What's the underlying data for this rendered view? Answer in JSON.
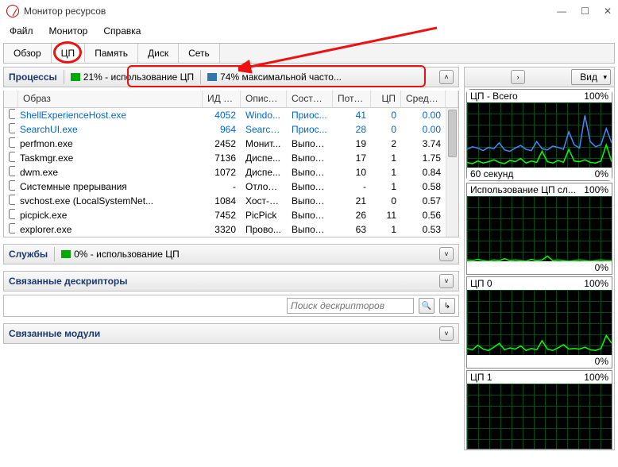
{
  "window": {
    "title": "Монитор ресурсов"
  },
  "winbuttons": {
    "min": "—",
    "max": "☐",
    "close": "✕"
  },
  "menu": {
    "file": "Файл",
    "monitor": "Монитор",
    "help": "Справка"
  },
  "tabs": {
    "overview": "Обзор",
    "cpu": "ЦП",
    "memory": "Память",
    "disk": "Диск",
    "network": "Сеть"
  },
  "processes": {
    "title": "Процессы",
    "chip_cpu": "21% - использование ЦП",
    "chip_freq": "74% максимальной часто...",
    "columns": {
      "image": "Образ",
      "pid": "ИД п...",
      "desc": "Описа...",
      "status": "Состоя...",
      "threads": "Потоки",
      "cpu": "ЦП",
      "avg": "Средн..."
    },
    "rows": [
      {
        "image": "ShellExperienceHost.exe",
        "pid": "4052",
        "desc": "Windo...",
        "status": "Приос...",
        "threads": "41",
        "cpu": "0",
        "avg": "0.00",
        "link": true
      },
      {
        "image": "SearchUI.exe",
        "pid": "964",
        "desc": "Search ...",
        "status": "Приос...",
        "threads": "28",
        "cpu": "0",
        "avg": "0.00",
        "link": true
      },
      {
        "image": "perfmon.exe",
        "pid": "2452",
        "desc": "Монит...",
        "status": "Выпол...",
        "threads": "19",
        "cpu": "2",
        "avg": "3.74",
        "link": false
      },
      {
        "image": "Taskmgr.exe",
        "pid": "7136",
        "desc": "Диспе...",
        "status": "Выпол...",
        "threads": "17",
        "cpu": "1",
        "avg": "1.75",
        "link": false
      },
      {
        "image": "dwm.exe",
        "pid": "1072",
        "desc": "Диспе...",
        "status": "Выпол...",
        "threads": "10",
        "cpu": "1",
        "avg": "0.84",
        "link": false
      },
      {
        "image": "Системные прерывания",
        "pid": "-",
        "desc": "Отлож...",
        "status": "Выпол...",
        "threads": "-",
        "cpu": "1",
        "avg": "0.58",
        "link": false
      },
      {
        "image": "svchost.exe (LocalSystemNet...",
        "pid": "1084",
        "desc": "Хост-п...",
        "status": "Выпол...",
        "threads": "21",
        "cpu": "0",
        "avg": "0.57",
        "link": false
      },
      {
        "image": "picpick.exe",
        "pid": "7452",
        "desc": "PicPick",
        "status": "Выпол...",
        "threads": "26",
        "cpu": "11",
        "avg": "0.56",
        "link": false
      },
      {
        "image": "explorer.exe",
        "pid": "3320",
        "desc": "Прово...",
        "status": "Выпол...",
        "threads": "63",
        "cpu": "1",
        "avg": "0.53",
        "link": false
      }
    ]
  },
  "services": {
    "title": "Службы",
    "chip": "0% - использование ЦП"
  },
  "handles": {
    "title": "Связанные дескрипторы",
    "placeholder": "Поиск дескрипторов"
  },
  "modules": {
    "title": "Связанные модули"
  },
  "right": {
    "view": "Вид",
    "graphs": [
      {
        "title": "ЦП - Всего",
        "max": "100%",
        "footL": "60 секунд",
        "footR": "0%",
        "hi": true,
        "blue": true
      },
      {
        "title": "Использование ЦП сл...",
        "max": "100%",
        "footR": "0%"
      },
      {
        "title": "ЦП 0",
        "max": "100%",
        "footR": "0%"
      },
      {
        "title": "ЦП 1",
        "max": "100%"
      }
    ]
  },
  "icons": {
    "chev_up": "˄",
    "chev_down": "˅",
    "chev_right": "›",
    "chev_left": "‹",
    "search": "🔍",
    "go": "↳"
  },
  "chart_data": [
    {
      "type": "line",
      "title": "ЦП - Всего",
      "ylim": [
        0,
        100
      ],
      "xlabel": "60 секунд",
      "series": [
        {
          "name": "blue",
          "values": [
            28,
            32,
            30,
            26,
            31,
            29,
            38,
            27,
            25,
            30,
            34,
            28,
            26,
            40,
            29,
            27,
            33,
            31,
            28,
            55,
            35,
            30,
            80,
            40,
            32,
            35,
            60,
            38
          ]
        },
        {
          "name": "green",
          "values": [
            8,
            6,
            10,
            7,
            9,
            12,
            8,
            6,
            11,
            9,
            14,
            7,
            10,
            8,
            25,
            9,
            7,
            11,
            8,
            28,
            10,
            9,
            12,
            8,
            7,
            10,
            35,
            9
          ]
        }
      ]
    },
    {
      "type": "line",
      "title": "Использование ЦП служб",
      "ylim": [
        0,
        100
      ],
      "series": [
        {
          "name": "green",
          "values": [
            2,
            1,
            3,
            1,
            0,
            2,
            1,
            4,
            1,
            2,
            1,
            0,
            3,
            1,
            2,
            8,
            1,
            2,
            1,
            0,
            1,
            2,
            1,
            0,
            1,
            2,
            1,
            1
          ]
        }
      ]
    },
    {
      "type": "line",
      "title": "ЦП 0",
      "ylim": [
        0,
        100
      ],
      "series": [
        {
          "name": "green",
          "values": [
            10,
            8,
            15,
            9,
            7,
            12,
            18,
            8,
            11,
            9,
            14,
            7,
            10,
            8,
            22,
            9,
            7,
            11,
            16,
            9,
            10,
            9,
            12,
            8,
            7,
            10,
            30,
            18
          ]
        }
      ]
    }
  ]
}
